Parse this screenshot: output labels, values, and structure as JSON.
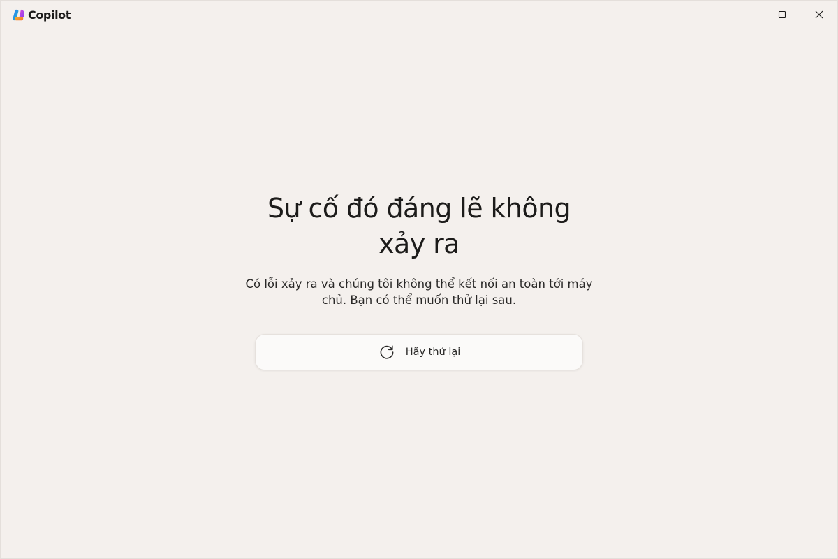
{
  "app": {
    "title": "Copilot",
    "logo_icon": "copilot-logo-icon"
  },
  "window_controls": {
    "minimize_icon": "minimize-icon",
    "maximize_icon": "maximize-icon",
    "close_icon": "close-icon"
  },
  "error": {
    "headline": "Sự cố đó đáng lẽ không xảy ra",
    "message": "Có lỗi xảy ra và chúng tôi không thể kết nối an toàn tới máy chủ. Bạn có thể muốn thử lại sau.",
    "retry_label": "Hãy thử lại",
    "retry_icon": "refresh-icon"
  },
  "colors": {
    "background": "#f4f0ed",
    "button_background": "#fbfaf9",
    "text": "#1c1b1a"
  }
}
